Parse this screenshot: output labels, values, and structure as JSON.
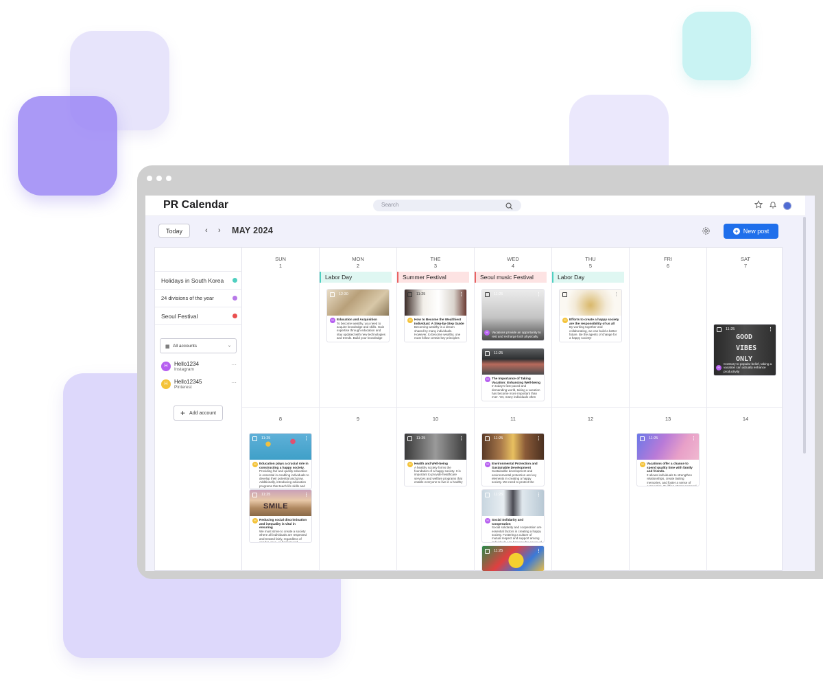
{
  "app": {
    "title": "PR Calendar",
    "search_placeholder": "Search"
  },
  "toolbar": {
    "today": "Today",
    "prev": "‹",
    "next": "›",
    "month": "MAY 2024",
    "new_post": "New post"
  },
  "calendars": [
    {
      "label": "Holidays in South Korea",
      "color": "#4fcfc0"
    },
    {
      "label": "24 divisions of the year",
      "color": "#b779e8"
    },
    {
      "label": "Seoul Festival",
      "color": "#ea4f4f"
    }
  ],
  "accounts_select": "All accounts",
  "accounts": [
    {
      "initial": "H",
      "name": "Hello1234",
      "platform": "Instagram",
      "color": "#b65ff0",
      "more": "···"
    },
    {
      "initial": "H",
      "name": "Hello12345",
      "platform": "Pinterest",
      "color": "#f4c33a",
      "more": "···"
    }
  ],
  "add_account": "Add account",
  "week1": [
    {
      "dow": "SUN",
      "num": "1"
    },
    {
      "dow": "MON",
      "num": "2"
    },
    {
      "dow": "THE",
      "num": "3"
    },
    {
      "dow": "WED",
      "num": "4"
    },
    {
      "dow": "THU",
      "num": "5"
    },
    {
      "dow": "FRI",
      "num": "6"
    },
    {
      "dow": "SAT",
      "num": "7"
    }
  ],
  "week2": [
    "8",
    "9",
    "10",
    "11",
    "12",
    "13",
    "14"
  ],
  "events": [
    {
      "label": "Labor Day",
      "bg": "#dff7f2",
      "border": "#4fcfc0"
    },
    {
      "label": "Summer Festival",
      "bg": "#fde3e3",
      "border": "#ea6262"
    },
    {
      "label": "Seoul music Festival",
      "bg": "#fde3e3",
      "border": "#ea6262"
    },
    {
      "label": "Labor Day",
      "bg": "#dff7f2",
      "border": "#4fcfc0"
    }
  ],
  "posts": [
    {
      "time": "12:30",
      "menu": "⋮",
      "title": "Education and Acquisition",
      "text": "To become wealthy, you need to acquire knowledge and skills. Gain expertise through education and stay updated with new technologies and trends. Build your knowledge through",
      "color": "#b65ff0",
      "initial": "H"
    },
    {
      "time": "11:25",
      "menu": "⋮",
      "title": "How to Become the Wealthiest Individual: A Step-by-Step Guide",
      "text": "Becoming wealthy is a dream shared by many individuals. However, to become wealthy, one must follow certain key principles and strategies.",
      "color": "#f4c33a",
      "initial": "H"
    },
    {
      "time": "11:25",
      "menu": "⋮",
      "title": "",
      "text": "Vacations provide an opportunity to rest and recharge both physically.",
      "color": "#b65ff0",
      "initial": "H"
    },
    {
      "time": "11:25",
      "menu": "⋮",
      "title": "Efforts to create a happy society are the responsibility of us all",
      "text": "By working together and collaborating, we can build a better future. Be the agents of change for a happy society!",
      "color": "#f4c33a",
      "initial": "H"
    },
    {
      "time": "11:25",
      "menu": "⋮",
      "title": "",
      "text": "Contrary to popular belief, taking a vacation can actually enhance productivity",
      "color": "#b65ff0",
      "initial": "H",
      "sign": [
        "GOOD",
        "VIBES",
        "ONLY"
      ]
    },
    {
      "time": "11:25",
      "menu": "",
      "title": "The Importance of Taking Vacation: Enhancing Well-being",
      "text": "In today's fast-paced and demanding world, taking a vacation has become more important than ever. Yet, many individuals often overlook the",
      "color": "#b65ff0",
      "initial": "H"
    },
    {
      "time": "11:25",
      "menu": "⋮",
      "title": "Education plays a crucial role in constructing a happy society.",
      "text": "Providing fair and quality education is essential in enabling individuals to develop their potential and grow. Additionally, introducing education programs that teach life skills and positive values can promote social",
      "color": "#f4c33a",
      "initial": "H"
    },
    {
      "time": "11:25",
      "menu": "⋮",
      "title": "Health and Well-being",
      "text": "A healthy society forms the foundation of a happy society. It is important to provide healthcare services and welfare programs that enable everyone to live in a healthy environment. Establishing support systems that promote physical",
      "color": "#f4c33a",
      "initial": "H"
    },
    {
      "time": "11:25",
      "menu": "⋮",
      "title": "Environmental Protection and Sustainable Development",
      "text": "Sustainable development and environmental protection are key elements in creating a happy society. We need to protect the natural",
      "color": "#b65ff0",
      "initial": "H"
    },
    {
      "time": "11:25",
      "menu": "⋮",
      "title": "Vacations offer a chance to spend quality time with family and friends.",
      "text": "It allows individuals to strengthen relationships, create lasting memories, and foster a sense of connection. Building strong personal",
      "color": "#f4c33a",
      "initial": "H"
    },
    {
      "time": "11:25",
      "menu": "⋮",
      "title": "Reducing social discrimination and inequality is vital in ensuring",
      "text": "We must strive to create a society where all individuals are respected and treated fairly, regardless of gender, race, or background.",
      "color": "#f4c33a",
      "initial": "H",
      "sign": [
        "SMILE"
      ]
    },
    {
      "time": "11:25",
      "menu": "⋮",
      "title": "Social Solidarity and Cooperation",
      "text": "Social solidarity and cooperation are essential factors in creating a happy society. Fostering a culture of mutual respect and support among individuals can harness the power of",
      "color": "#b65ff0",
      "initial": "H"
    },
    {
      "time": "11:25",
      "menu": "⋮"
    }
  ]
}
